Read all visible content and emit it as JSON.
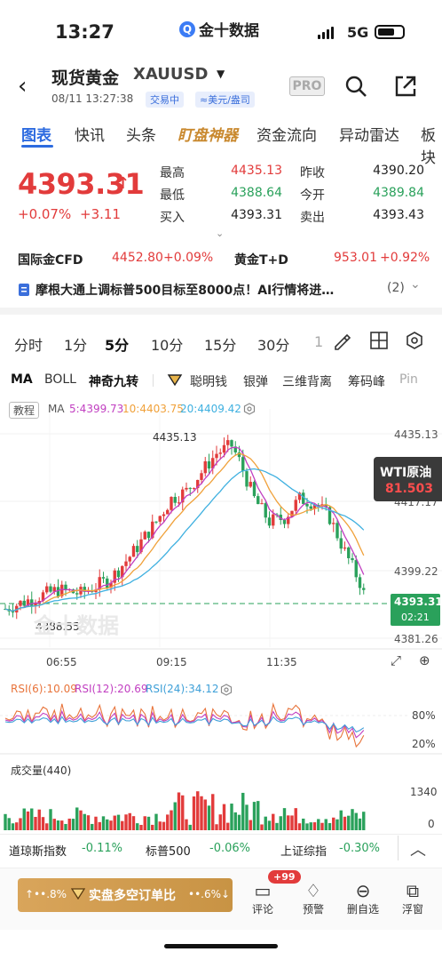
{
  "status": {
    "time": "13:27",
    "app": "金十数据",
    "network": "5G"
  },
  "header": {
    "title": "现货黄金",
    "code": "XAUUSD",
    "datetime": "08/11 13:27:38",
    "tag_trading": "交易中",
    "tag_unit": "≈美元/盎司",
    "pro": "PRO"
  },
  "tabs": [
    "图表",
    "快讯",
    "头条",
    "盯盘神器",
    "资金流向",
    "异动雷达",
    "板块"
  ],
  "quote": {
    "price": "4393.31",
    "change": "+0.07%",
    "change_abs": "+3.11",
    "high_label": "最高",
    "high": "4435.13",
    "low_label": "最低",
    "low": "4388.64",
    "bid_label": "买入",
    "bid": "4393.31",
    "prev_label": "昨收",
    "prev": "4390.20",
    "open_label": "今开",
    "open": "4389.84",
    "ask_label": "卖出",
    "ask": "4393.43"
  },
  "related": [
    {
      "name": "国际金CFD",
      "price": "4452.80",
      "change": "+0.09%"
    },
    {
      "name": "黄金T+D",
      "price": "953.01",
      "change": "+0.92%"
    }
  ],
  "news": {
    "text": "摩根大通上调标普500目标至8000点！AI行情将进…",
    "count": "(2)"
  },
  "periods": [
    "分时",
    "1分",
    "5分",
    "10分",
    "15分",
    "30分",
    "1"
  ],
  "indicators": [
    "MA",
    "BOLL",
    "神奇九转",
    "聪明钱",
    "银弹",
    "三维背离",
    "筹码峰",
    "Pin"
  ],
  "chart": {
    "tutorial": "教程",
    "ma_label": "MA",
    "ma5": "5:4399.73",
    "ma10": "10:4403.75",
    "ma20": "20:4409.42",
    "y_labels": [
      "4435.13",
      "4417.17",
      "4399.22",
      "4381.26"
    ],
    "current_price": "4393.31",
    "countdown": "02:21",
    "high_mark": "4435.13",
    "low_mark": "4388.55",
    "x_labels": [
      "06:55",
      "09:15",
      "11:35"
    ],
    "watermark": "金十数据",
    "wti_label": "WTI原油",
    "wti_price": "81.503",
    "rsi6": "RSI(6):10.09",
    "rsi12": "RSI(12):20.69",
    "rsi24": "RSI(24):34.12",
    "rsi_levels": [
      "80%",
      "20%"
    ],
    "vol_label": "成交量(440)",
    "vol_levels": [
      "1340",
      "0"
    ],
    "colors": {
      "up": "#e23b3b",
      "down": "#2aa15b",
      "ma5": "#c13fc1",
      "ma10": "#f0a13a",
      "ma20": "#3fb0e0"
    }
  },
  "chart_data": {
    "type": "candlestick",
    "y_range": [
      4381.26,
      4435.13
    ],
    "x_ticks": [
      "06:55",
      "09:15",
      "11:35"
    ]
  },
  "bottom_ticker": [
    {
      "name": "道琼斯指数",
      "change": "-0.11%"
    },
    {
      "name": "标普500",
      "change": "-0.06%"
    },
    {
      "name": "上证综指",
      "change": "-0.30%"
    }
  ],
  "bottom": {
    "gold_left": "↑••.8%",
    "gold_text": "实盘多空订单比",
    "gold_right": "••.6%↓",
    "badge": "+99",
    "actions": [
      "评论",
      "预警",
      "删自选",
      "浮窗"
    ]
  }
}
